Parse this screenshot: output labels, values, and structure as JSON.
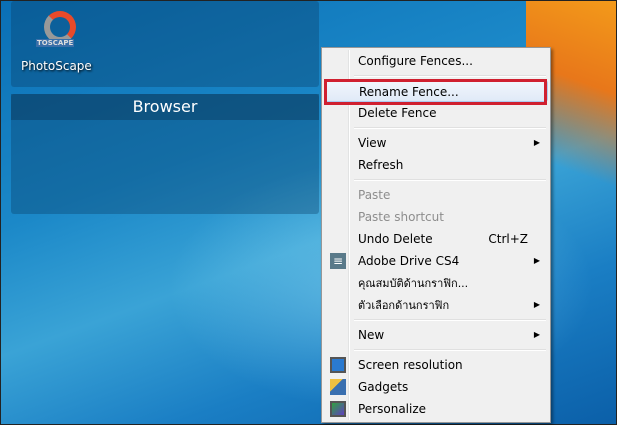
{
  "desktop": {
    "icon_label": "PhotoScape",
    "icon_logo_text": "TOSCAPE",
    "fence_title": "Browser"
  },
  "menu": {
    "configure": "Configure Fences...",
    "rename": "Rename Fence...",
    "delete": "Delete Fence",
    "view": "View",
    "refresh": "Refresh",
    "paste": "Paste",
    "paste_shortcut": "Paste shortcut",
    "undo": "Undo Delete",
    "undo_shortcut": "Ctrl+Z",
    "adobe_drive": "Adobe Drive CS4",
    "graphics_properties": "คุณสมบัติด้านกราฟิก...",
    "graphics_options": "ตัวเลือกด้านกราฟิก",
    "new": "New",
    "screen_resolution": "Screen resolution",
    "gadgets": "Gadgets",
    "personalize": "Personalize"
  },
  "highlight_color": "#d02030"
}
